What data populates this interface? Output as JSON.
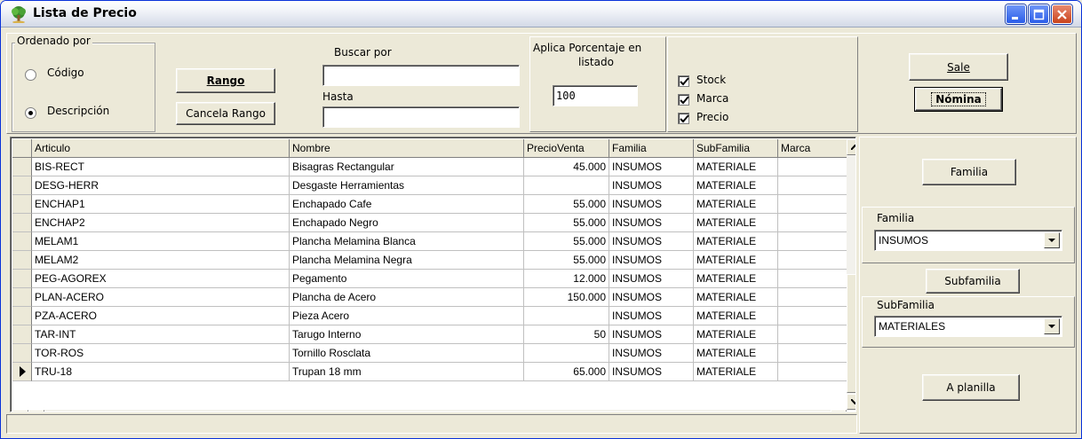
{
  "window": {
    "title": "Lista de Precio",
    "icon": "app-tree-icon"
  },
  "order": {
    "legend": "Ordenado por",
    "option_code": "Código",
    "option_desc": "Descripción",
    "selected": "Descripción"
  },
  "range": {
    "rango_label": "Rango",
    "cancel_label": "Cancela Rango",
    "buscar_label": "Buscar por",
    "buscar_value": "",
    "hasta_label": "Hasta",
    "hasta_value": ""
  },
  "percent": {
    "label_line1": "Aplica Porcentaje en",
    "label_line2": "listado",
    "value": "100"
  },
  "checks": {
    "stock": "Stock",
    "marca": "Marca",
    "precio": "Precio"
  },
  "actions": {
    "sale": "Sale",
    "nomina": "Nómina",
    "familia_btn": "Familia",
    "subfamilia_btn": "Subfamilia",
    "planilla": "A planilla"
  },
  "filters": {
    "familia_label": "Familia",
    "familia_value": "INSUMOS",
    "subfamilia_label": "SubFamilia",
    "subfamilia_value": "MATERIALES"
  },
  "grid": {
    "columns": [
      "Articulo",
      "Nombre",
      "PrecioVenta",
      "Familia",
      "SubFamilia",
      "Marca"
    ],
    "rows": [
      [
        "BIS-RECT",
        "Bisagras Rectangular",
        "45.000",
        "INSUMOS",
        "MATERIALE",
        ""
      ],
      [
        "DESG-HERR",
        "Desgaste Herramientas",
        "",
        "INSUMOS",
        "MATERIALE",
        ""
      ],
      [
        "ENCHAP1",
        "Enchapado Cafe",
        "55.000",
        "INSUMOS",
        "MATERIALE",
        ""
      ],
      [
        "ENCHAP2",
        "Enchapado Negro",
        "55.000",
        "INSUMOS",
        "MATERIALE",
        ""
      ],
      [
        "MELAM1",
        "Plancha Melamina Blanca",
        "55.000",
        "INSUMOS",
        "MATERIALE",
        ""
      ],
      [
        "MELAM2",
        "Plancha Melamina Negra",
        "55.000",
        "INSUMOS",
        "MATERIALE",
        ""
      ],
      [
        "PEG-AGOREX",
        "Pegamento",
        "12.000",
        "INSUMOS",
        "MATERIALE",
        ""
      ],
      [
        "PLAN-ACERO",
        "Plancha de Acero",
        "150.000",
        "INSUMOS",
        "MATERIALE",
        ""
      ],
      [
        "PZA-ACERO",
        "Pieza Acero",
        "",
        "INSUMOS",
        "MATERIALE",
        ""
      ],
      [
        "TAR-INT",
        "Tarugo Interno",
        "50",
        "INSUMOS",
        "MATERIALE",
        ""
      ],
      [
        "TOR-ROS",
        "Tornillo Rosclata",
        "",
        "INSUMOS",
        "MATERIALE",
        ""
      ],
      [
        "TRU-18",
        "Trupan 18 mm",
        "65.000",
        "INSUMOS",
        "MATERIALE",
        ""
      ]
    ],
    "current_row": 11
  }
}
